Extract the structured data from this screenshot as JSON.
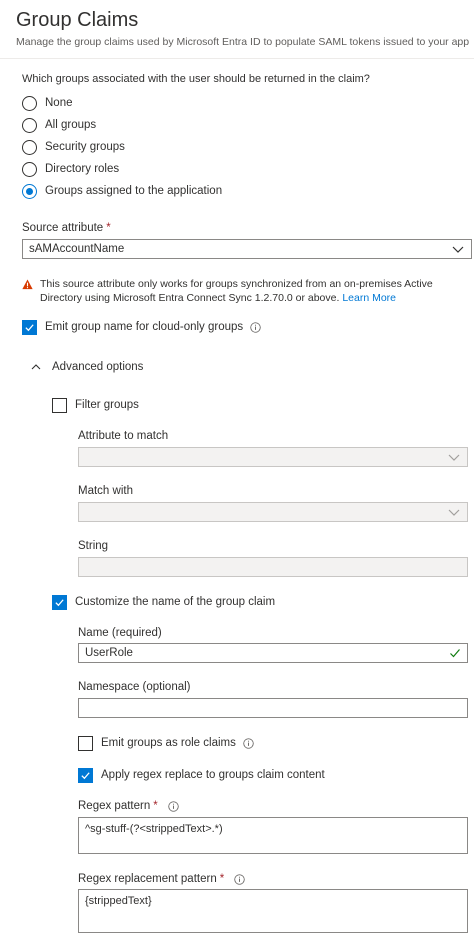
{
  "header": {
    "title": "Group Claims",
    "subtitle": "Manage the group claims used by Microsoft Entra ID to populate SAML tokens issued to your app"
  },
  "groups_question": "Which groups associated with the user should be returned in the claim?",
  "group_options": [
    {
      "label": "None",
      "selected": false
    },
    {
      "label": "All groups",
      "selected": false
    },
    {
      "label": "Security groups",
      "selected": false
    },
    {
      "label": "Directory roles",
      "selected": false
    },
    {
      "label": "Groups assigned to the application",
      "selected": true
    }
  ],
  "source_attribute": {
    "label": "Source attribute",
    "required_mark": "*",
    "value": "sAMAccountName"
  },
  "warning": {
    "text": "This source attribute only works for groups synchronized from an on-premises Active Directory using Microsoft Entra Connect Sync 1.2.70.0 or above.",
    "link": "Learn More",
    "color": "#d83b01"
  },
  "emit_cloud_only": {
    "label": "Emit group name for cloud-only groups",
    "checked": true
  },
  "advanced": {
    "label": "Advanced options",
    "expanded": true,
    "filter_groups": {
      "label": "Filter groups",
      "checked": false
    },
    "attribute_to_match": {
      "label": "Attribute to match",
      "value": ""
    },
    "match_with": {
      "label": "Match with",
      "value": ""
    },
    "string": {
      "label": "String",
      "value": ""
    },
    "customize_name": {
      "label": "Customize the name of the group claim",
      "checked": true
    },
    "name": {
      "label": "Name (required)",
      "value": "UserRole"
    },
    "namespace": {
      "label": "Namespace (optional)",
      "value": ""
    },
    "emit_as_roles": {
      "label": "Emit groups as role claims",
      "checked": false
    },
    "apply_regex": {
      "label": "Apply regex replace to groups claim content",
      "checked": true
    },
    "regex_pattern": {
      "label": "Regex pattern",
      "required_mark": "*",
      "value": "^sg-stuff-(?<strippedText>.*)"
    },
    "regex_replacement": {
      "label": "Regex replacement pattern",
      "required_mark": "*",
      "value": "{strippedText}"
    }
  },
  "colors": {
    "accent": "#0078d4",
    "required": "#a4262c",
    "valid": "#107c10"
  }
}
